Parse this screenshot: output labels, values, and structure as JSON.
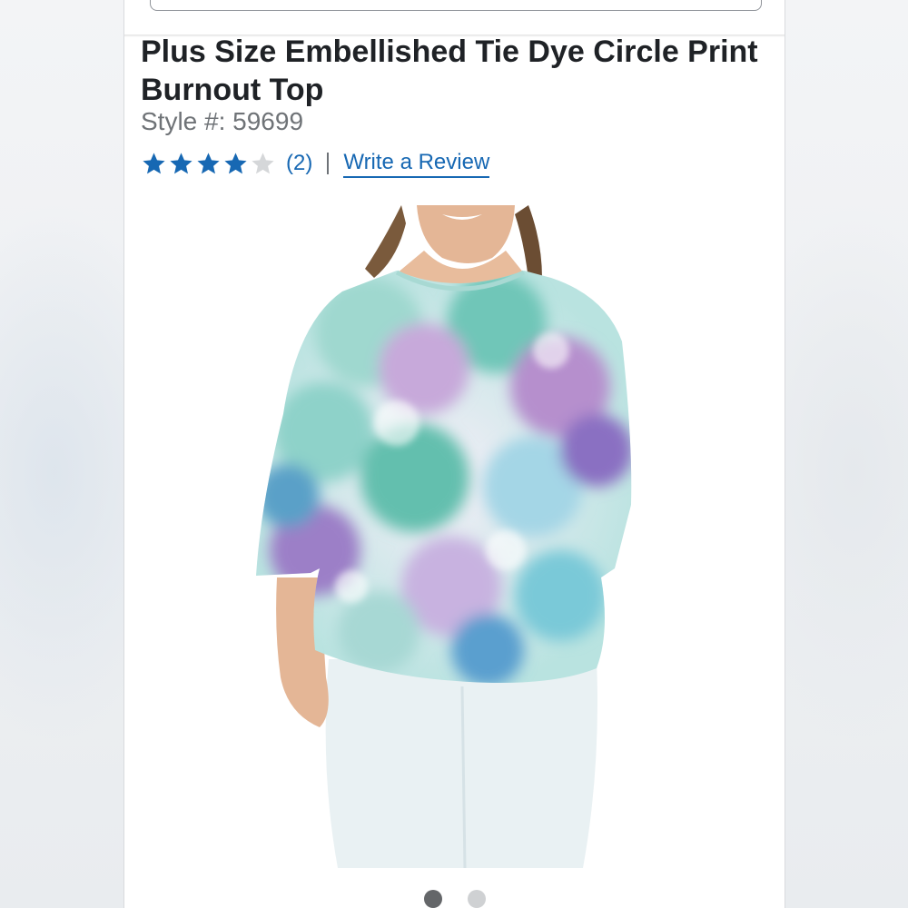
{
  "product": {
    "title": "Plus Size Embellished Tie Dye Circle Print Burnout Top",
    "style_label": "Style #: 59699"
  },
  "rating": {
    "stars": 4,
    "max_stars": 5,
    "count_text": "(2)",
    "write_review_label": "Write a Review"
  },
  "gallery": {
    "image_description_icon": "product-photo-model",
    "slide_count": 2,
    "active_slide": 1
  },
  "colors": {
    "star_filled": "#1768b3",
    "star_empty": "#d5d7d9",
    "link": "#1768b3",
    "title": "#1f2226",
    "style_text": "#6f7377"
  }
}
